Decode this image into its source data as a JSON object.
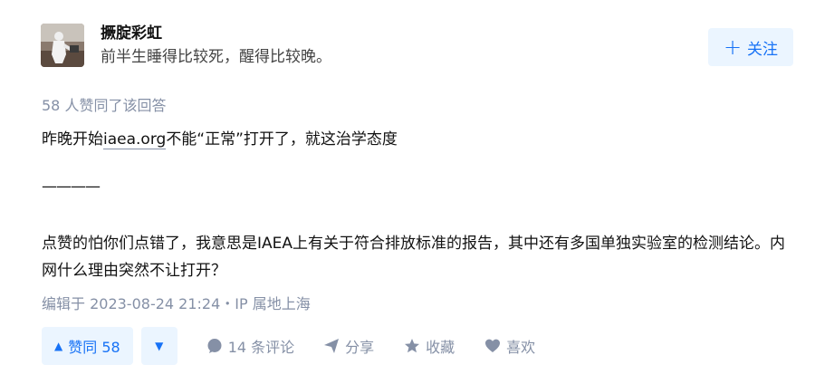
{
  "author": {
    "name": "撅腚彩虹",
    "bio": "前半生睡得比较死，醒得比较晚。",
    "avatar_icon": "avatar-photo"
  },
  "follow_button": {
    "label": "关注",
    "icon": "plus-icon"
  },
  "upvote_summary": "58 人赞同了该回答",
  "content": {
    "p1_before": "昨晚开始",
    "p1_link": "iaea.org",
    "p1_after": "不能“正常”打开了，就这治学态度",
    "divider": "————",
    "p2": "点赞的怕你们点错了，我意思是IAEA上有关于符合排放标准的报告，其中还有多国单独实验室的检测结论。内网什么理由突然不让打开？"
  },
  "edit_info": "编辑于 2023-08-24 21:24・IP 属地上海",
  "actions": {
    "vote_up": "赞同 58",
    "comment": "14 条评论",
    "share": "分享",
    "favorite": "收藏",
    "like": "喜欢"
  },
  "colors": {
    "accent": "#1772f6",
    "accent_bg": "#ebf5ff",
    "muted": "#8590a6"
  }
}
